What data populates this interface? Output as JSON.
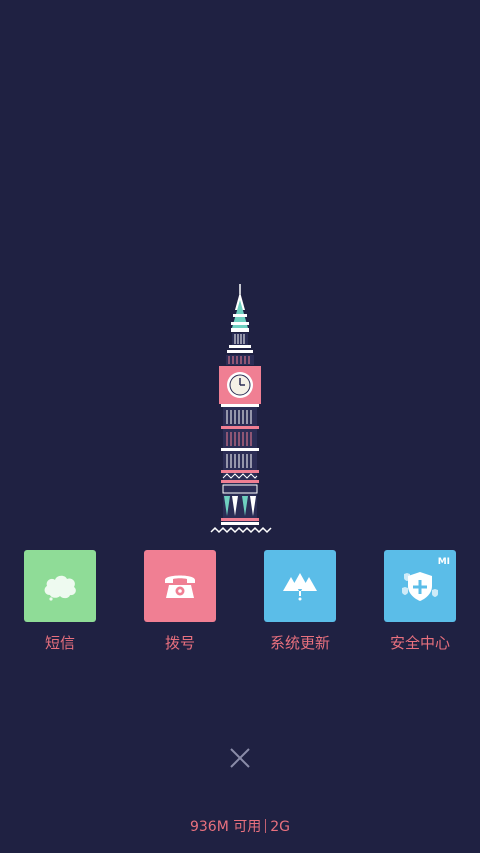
{
  "apps": [
    {
      "label": "短信",
      "icon": "message-cloud-icon",
      "color": "#8fdc97"
    },
    {
      "label": "拨号",
      "icon": "phone-icon",
      "color": "#f07f93"
    },
    {
      "label": "系统更新",
      "icon": "update-trees-icon",
      "color": "#5bbde8"
    },
    {
      "label": "安全中心",
      "icon": "security-shield-icon",
      "color": "#5bbde8",
      "badge": "MI"
    }
  ],
  "status": {
    "memory": "936M 可用",
    "network": "2G"
  },
  "colors": {
    "background": "#1f2142",
    "accent": "#e8707e"
  }
}
